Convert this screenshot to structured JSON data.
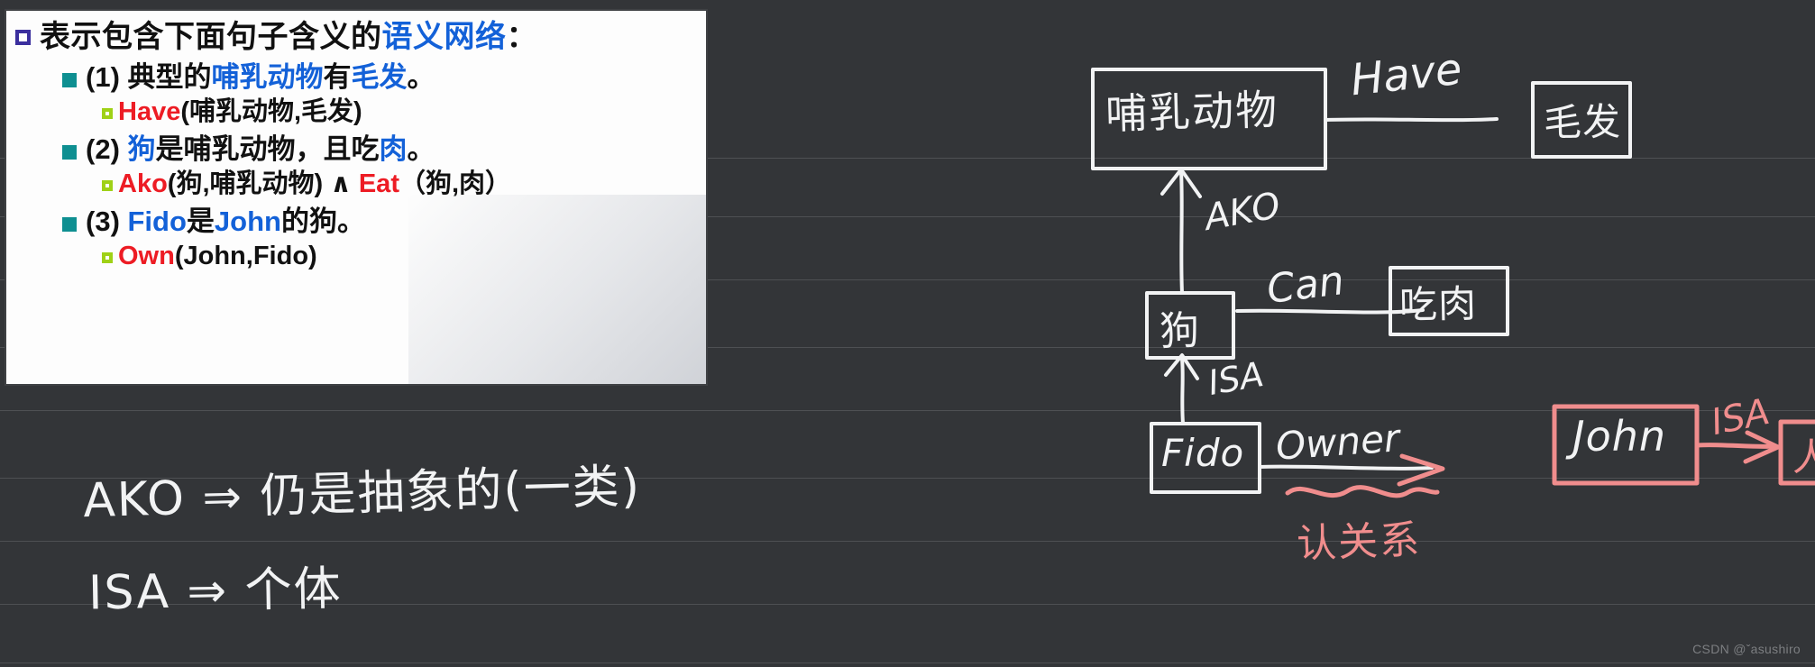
{
  "page": {
    "background_color": "#333538",
    "rule_color": "#4e5053",
    "rule_positions": [
      175,
      240,
      310,
      385,
      455,
      530,
      600,
      670,
      735
    ]
  },
  "watermark": {
    "text": "CSDN @ˇasushiro"
  },
  "slide": {
    "background_color": "#fdfdfd",
    "heading": {
      "bullet": "square-open-purple-icon",
      "parts": [
        {
          "text": "表示包含下面句子含义的",
          "color": "#111111"
        },
        {
          "text": "语义网络",
          "color": "#1361d8"
        },
        {
          "text": "：",
          "color": "#111111"
        }
      ]
    },
    "items": [
      {
        "bullet": "square-filled-teal-icon",
        "parts": [
          {
            "text": "(1) 典型的",
            "color": "#111111"
          },
          {
            "text": "哺乳动物",
            "color": "#1361d8"
          },
          {
            "text": "有",
            "color": "#111111"
          },
          {
            "text": "毛发",
            "color": "#1361d8"
          },
          {
            "text": "。",
            "color": "#111111"
          }
        ],
        "predicate": {
          "bullet": "square-open-green-icon",
          "parts": [
            {
              "text": "Have",
              "color": "#ed1c24"
            },
            {
              "text": "(哺乳动物,毛发)",
              "color": "#111111"
            }
          ]
        }
      },
      {
        "bullet": "square-filled-teal-icon",
        "parts": [
          {
            "text": "(2) ",
            "color": "#111111"
          },
          {
            "text": "狗",
            "color": "#1361d8"
          },
          {
            "text": "是哺乳动物，且吃",
            "color": "#111111"
          },
          {
            "text": "肉",
            "color": "#1361d8"
          },
          {
            "text": "。",
            "color": "#111111"
          }
        ],
        "predicate": {
          "bullet": "square-open-green-icon",
          "parts": [
            {
              "text": "Ako",
              "color": "#ed1c24"
            },
            {
              "text": "(狗,哺乳动物) ∧  ",
              "color": "#111111"
            },
            {
              "text": "Eat",
              "color": "#ed1c24"
            },
            {
              "text": "（狗,肉）",
              "color": "#111111"
            }
          ]
        }
      },
      {
        "bullet": "square-filled-teal-icon",
        "parts": [
          {
            "text": "(3) ",
            "color": "#111111"
          },
          {
            "text": "Fido",
            "color": "#1361d8"
          },
          {
            "text": "是",
            "color": "#111111"
          },
          {
            "text": "John",
            "color": "#1361d8"
          },
          {
            "text": "的狗。",
            "color": "#111111"
          }
        ],
        "predicate": {
          "bullet": "square-open-green-icon",
          "parts": [
            {
              "text": "Own",
              "color": "#ed1c24"
            },
            {
              "text": "(John,Fido)",
              "color": "#111111"
            }
          ]
        }
      }
    ]
  },
  "annotations": {
    "ink_color": "#f2f3f4",
    "pink_ink_color": "#f08d8d",
    "notes": [
      {
        "id": "note-ako",
        "text": "AKO ⇒ 仍是抽象的(一类)"
      },
      {
        "id": "note-isa",
        "text": "ISA ⇒ 个体"
      }
    ],
    "nodes": [
      {
        "id": "node-mammal",
        "label": "哺乳动物",
        "color": "#f2f3f4"
      },
      {
        "id": "node-hair",
        "label": "毛发",
        "color": "#f2f3f4"
      },
      {
        "id": "node-dog",
        "label": "狗",
        "color": "#f2f3f4"
      },
      {
        "id": "node-eatmeat",
        "label": "吃肉",
        "color": "#f2f3f4"
      },
      {
        "id": "node-fido",
        "label": "Fido",
        "color": "#f2f3f4"
      },
      {
        "id": "node-john",
        "label": "John",
        "color": "#f08d8d"
      },
      {
        "id": "node-person",
        "label": "人",
        "color": "#f08d8d"
      }
    ],
    "edges": [
      {
        "id": "edge-have",
        "label": "Have",
        "from": "node-mammal",
        "to": "node-hair",
        "color": "#f2f3f4"
      },
      {
        "id": "edge-ako",
        "label": "AKO",
        "from": "node-dog",
        "to": "node-mammal",
        "color": "#f2f3f4"
      },
      {
        "id": "edge-can",
        "label": "Can",
        "from": "node-dog",
        "to": "node-eatmeat",
        "color": "#f2f3f4"
      },
      {
        "id": "edge-isa-1",
        "label": "ISA",
        "from": "node-fido",
        "to": "node-dog",
        "color": "#f2f3f4"
      },
      {
        "id": "edge-owner",
        "label": "Owner",
        "from": "node-fido",
        "to": "node-john",
        "color": "#f2f3f4"
      },
      {
        "id": "edge-isa-2",
        "label": "ISA",
        "from": "node-john",
        "to": "node-person",
        "color": "#f08d8d"
      }
    ],
    "pink_mark": {
      "id": "pink-note-relation",
      "text": "认关系"
    }
  }
}
